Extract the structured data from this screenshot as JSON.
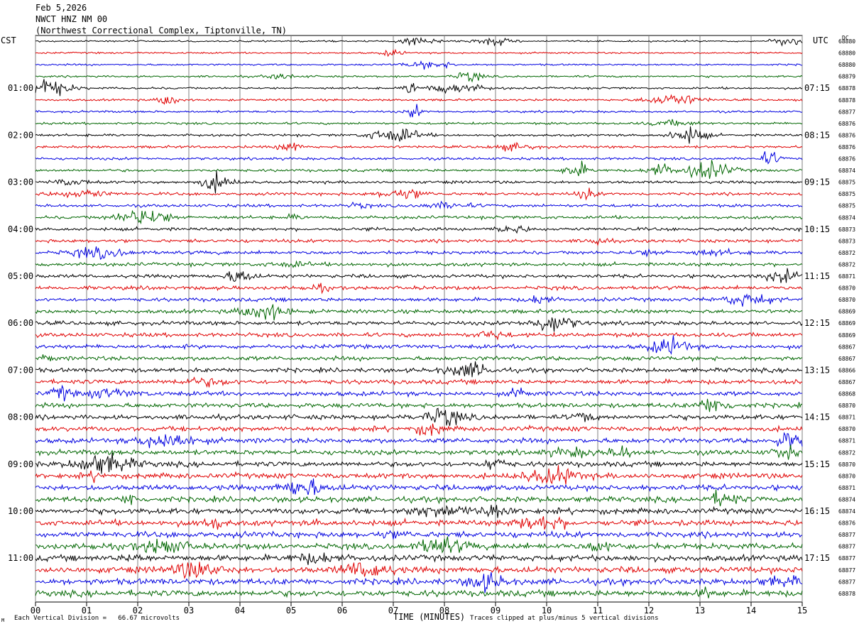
{
  "header": {
    "date": "Feb 5,2026",
    "station": "NWCT HNZ NM 00",
    "location": "(Northwest Correctional Complex, Tiptonville, TN)"
  },
  "left_tz": "CST",
  "right_tz": "UTC",
  "dc_label": "DC",
  "footer": {
    "scale": "Each Vertical Division =   66.67 microvolts",
    "clip": "Traces clipped at plus/minus 5 vertical divisions",
    "corner_mark": "M"
  },
  "chart_data": {
    "type": "line",
    "title": "",
    "xlabel": "TIME (MINUTES)",
    "xlim": [
      0,
      15
    ],
    "x_ticks": [
      "00",
      "01",
      "02",
      "03",
      "04",
      "05",
      "06",
      "07",
      "08",
      "09",
      "10",
      "11",
      "12",
      "13",
      "14",
      "15"
    ],
    "trace_colors": [
      "#000000",
      "#e00000",
      "#0000e0",
      "#006600"
    ],
    "left_time_labels": [
      "01:00",
      "02:00",
      "03:00",
      "04:00",
      "05:00",
      "06:00",
      "07:00",
      "08:00",
      "09:00",
      "10:00",
      "11:00"
    ],
    "right_time_labels": [
      "07:15",
      "08:15",
      "09:15",
      "10:15",
      "11:15",
      "12:15",
      "13:15",
      "14:15",
      "15:15",
      "16:15",
      "17:15"
    ],
    "dc_offsets": [
      "68880",
      "68880",
      "68880",
      "68879",
      "68878",
      "68878",
      "68877",
      "68876",
      "68876",
      "68876",
      "68876",
      "68874",
      "68875",
      "68875",
      "68875",
      "68874",
      "68873",
      "68873",
      "68872",
      "68872",
      "68871",
      "68870",
      "68870",
      "68869",
      "68869",
      "68869",
      "68867",
      "68867",
      "68866",
      "68867",
      "68868",
      "68870",
      "68871",
      "68870",
      "68871",
      "68872",
      "68870",
      "68870",
      "68871",
      "68874",
      "68874",
      "68876",
      "68877",
      "68877",
      "68877",
      "68877",
      "68877",
      "68878"
    ]
  }
}
